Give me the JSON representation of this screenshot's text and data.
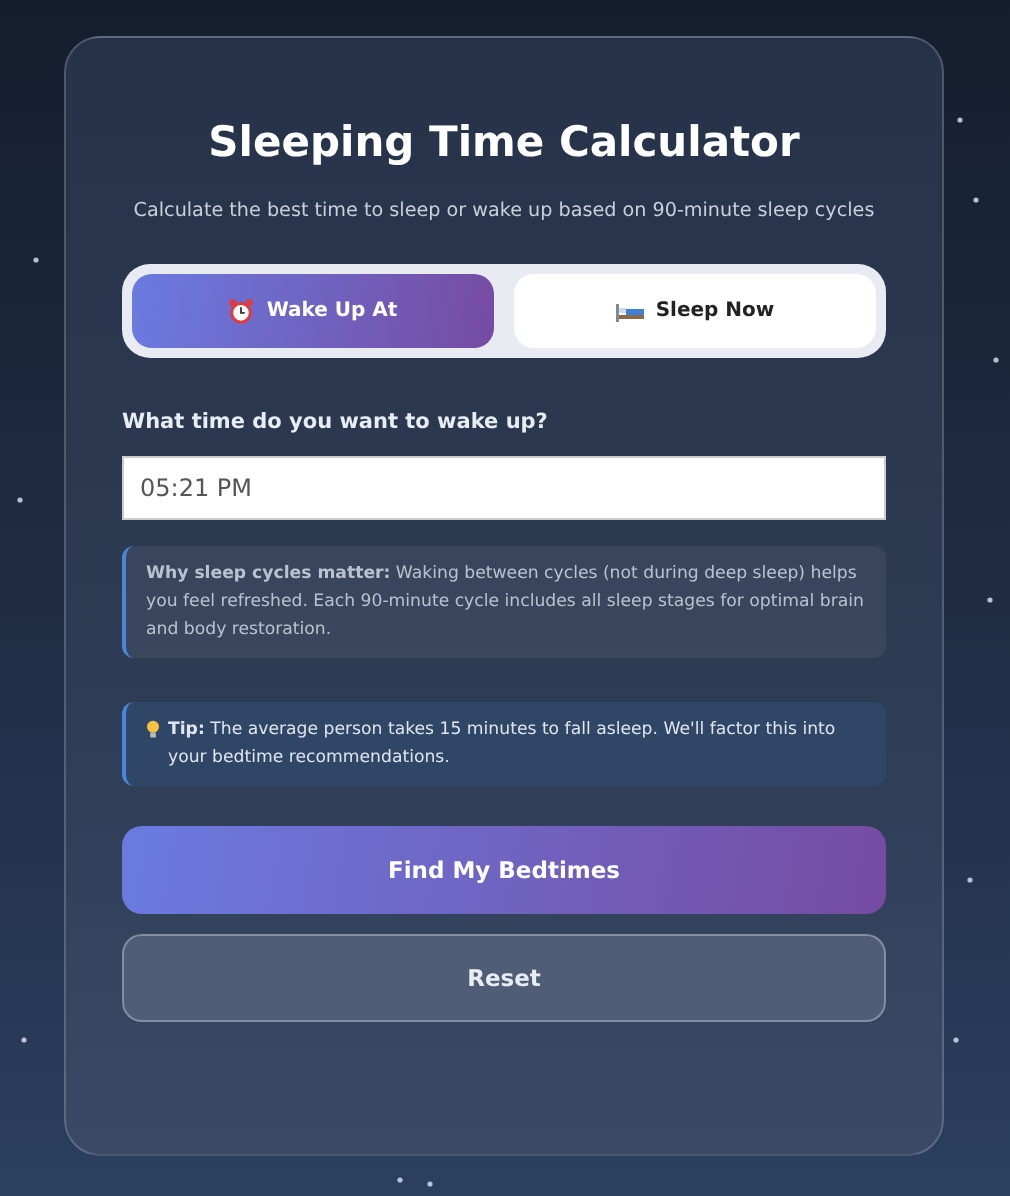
{
  "title": "Sleeping Time Calculator",
  "subtitle": "Calculate the best time to sleep or wake up based on 90-minute sleep cycles",
  "modes": [
    {
      "label": "Wake Up At",
      "kind": "clock",
      "selected": true
    },
    {
      "label": "Sleep Now",
      "kind": "bed",
      "selected": false
    }
  ],
  "time_field": {
    "label": "What time do you want to wake up?",
    "value": "05:21 PM"
  },
  "notes": [
    {
      "kind": "info",
      "text": "**Why sleep cycles matter:** Waking between cycles (not during deep sleep) helps you feel refreshed. Each 90-minute cycle includes all sleep stages for optimal brain and body restoration."
    },
    {
      "kind": "tip",
      "text": "**Tip:** The average person takes 15 minutes to fall asleep. We'll factor this into your bedtime recommendations."
    }
  ],
  "buttons": [
    {
      "label": "Find My Bedtimes",
      "kind": "primary"
    },
    {
      "label": "Reset",
      "kind": "secondary"
    }
  ]
}
